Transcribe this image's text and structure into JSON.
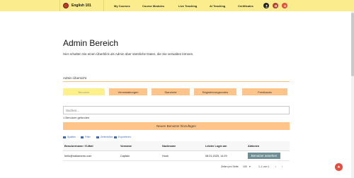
{
  "header": {
    "brand": "English 101",
    "nav": [
      "My Courses",
      "Course Modules",
      "Live Teaching",
      "AI Teaching",
      "Certificates"
    ],
    "icons": [
      "profile-icon",
      "settings-icon",
      "logout-icon"
    ]
  },
  "page": {
    "title": "Admin Bereich",
    "subtitle": "Hier erhalten Sie einen Überblick als Admin über sämtliche Daten, die Sie verwalten können.",
    "overview_label": "Admin Übersicht"
  },
  "tabs": [
    "Benutzer",
    "Veranstaltungen",
    "Standorte",
    "Registrierungscodes",
    "Feedbacks"
  ],
  "search": {
    "placeholder": "Suchen..."
  },
  "found_text": "1 Benutzer gefunden",
  "add_button": "Neuen Benutzer hinzufügen",
  "toolbar": [
    "Spalten",
    "Filter",
    "Zeilenhöhe",
    "Exportieren"
  ],
  "table": {
    "columns": [
      "Benutzername / E-Mail",
      "Vorname",
      "Nachname",
      "Letzter Login am",
      "Aktionen"
    ],
    "rows": [
      {
        "email": "hello@nakanomic.com",
        "first": "Captain",
        "last": "Hook",
        "login": "08.01.2025, 14:29",
        "action": "Benutzer ansehen"
      }
    ]
  },
  "pagination": {
    "rows_label": "Zeilen pro Seite:",
    "rows_value": "100",
    "range": "1–1 von 1"
  },
  "colors": {
    "topbar": "#fbed8e",
    "accent": "#ffc48a",
    "active_tab": "#fff08a",
    "fab": "#e74c3c",
    "view_button": "#6f8f95"
  }
}
